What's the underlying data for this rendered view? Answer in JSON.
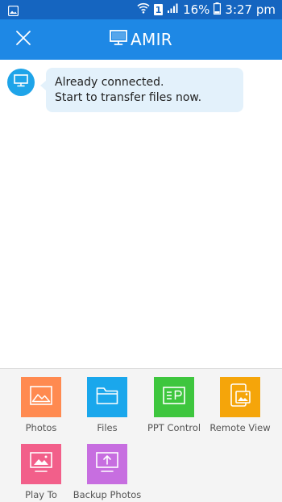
{
  "status_bar": {
    "battery": "16%",
    "time": "3:27 pm",
    "sim": "1",
    "icons": [
      "gallery-notification-icon",
      "wifi-icon",
      "sim-icon",
      "signal-icon",
      "battery-icon"
    ]
  },
  "app_bar": {
    "title": "AMIR",
    "close_icon": "close-icon",
    "device_icon": "monitor-icon",
    "color": "#1e88e5",
    "status_color": "#1565c0"
  },
  "chat": {
    "messages": [
      {
        "lines": [
          "Already connected.",
          "Start to transfer files now."
        ],
        "avatar_icon": "monitor-icon"
      }
    ]
  },
  "tools": [
    {
      "label": "Photos",
      "icon": "image-icon",
      "color": "#ff8a50"
    },
    {
      "label": "Files",
      "icon": "folder-icon",
      "color": "#1aa7ec"
    },
    {
      "label": "PPT Control",
      "icon": "presentation-icon",
      "color": "#3ec63e"
    },
    {
      "label": "Remote View",
      "icon": "remote-view-icon",
      "color": "#f5a50a"
    },
    {
      "label": "Play To",
      "icon": "cast-screen-icon",
      "color": "#f25f8a"
    },
    {
      "label": "Backup Photos",
      "icon": "upload-icon",
      "color": "#c76ee0"
    }
  ]
}
